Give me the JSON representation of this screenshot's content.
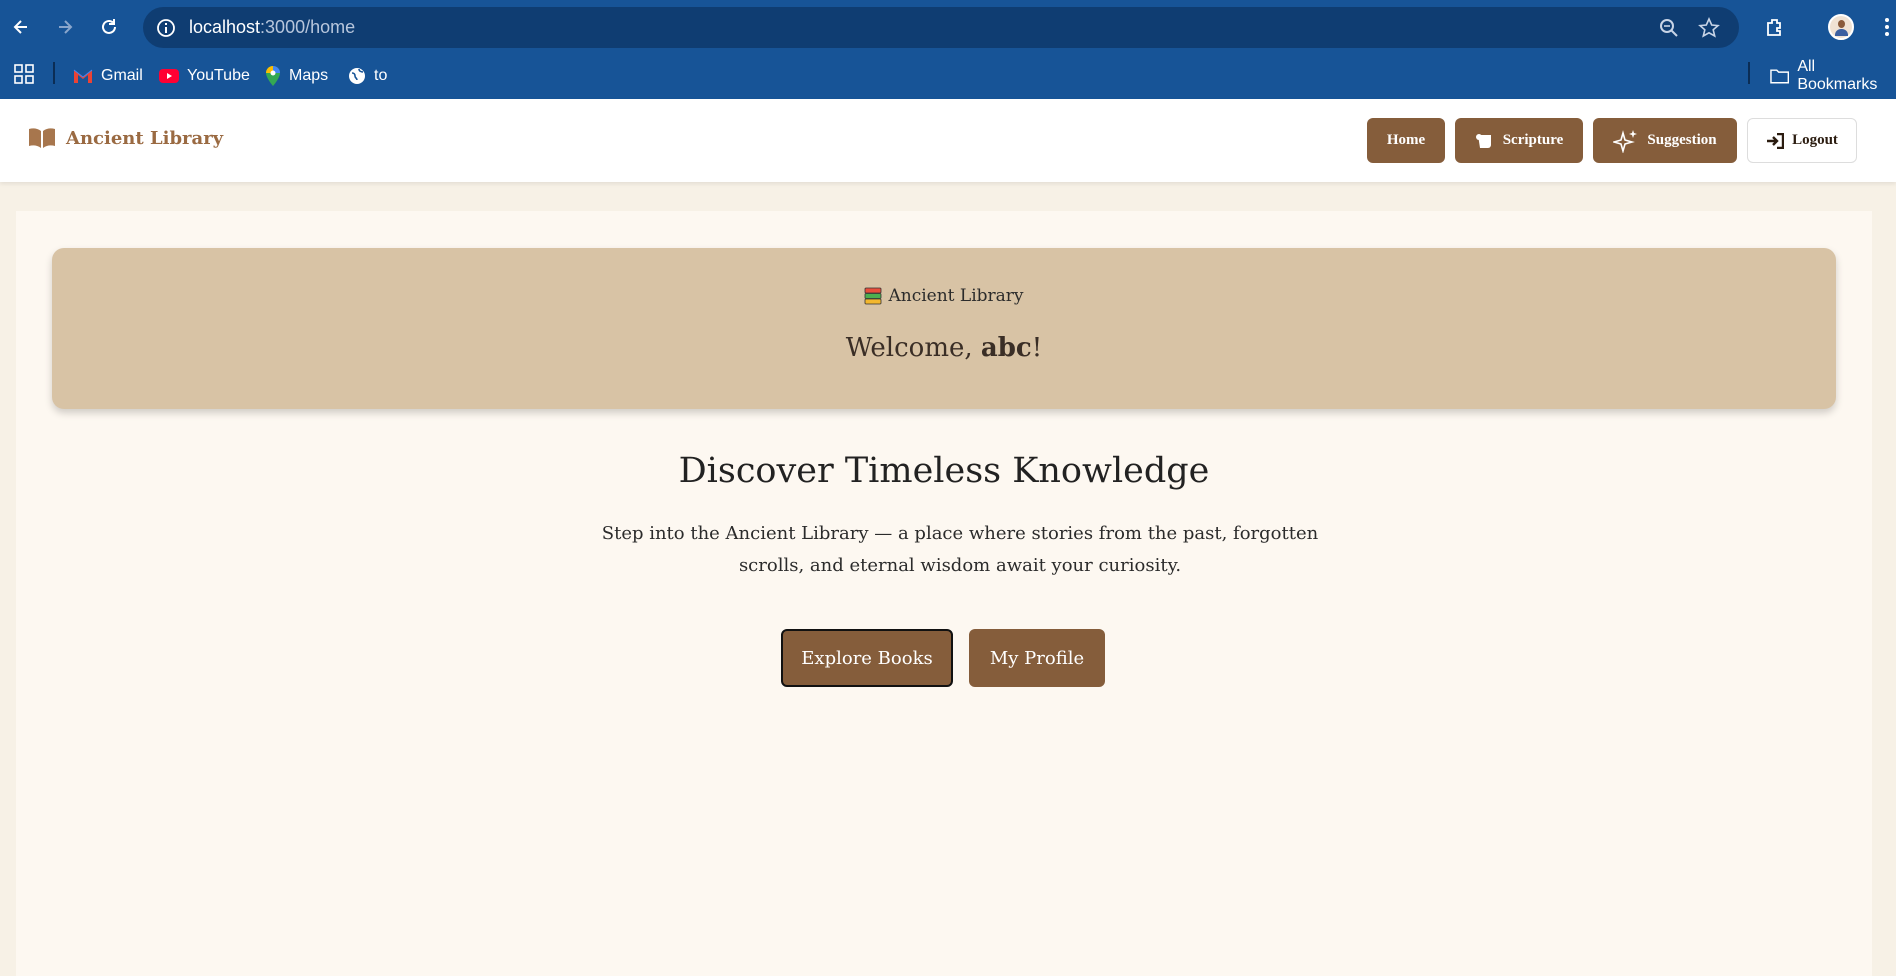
{
  "browser": {
    "url_host": "localhost",
    "url_path": ":3000/home",
    "bookmarks": [
      {
        "label": "Gmail"
      },
      {
        "label": "YouTube"
      },
      {
        "label": "Maps"
      },
      {
        "label": "to"
      }
    ],
    "all_bookmarks_label": "All Bookmarks"
  },
  "header": {
    "brand": "Ancient Library",
    "nav": {
      "home": "Home",
      "scripture": "Scripture",
      "suggestion": "Suggestion",
      "logout": "Logout"
    }
  },
  "welcome": {
    "label": "Ancient Library",
    "greeting_prefix": "Welcome, ",
    "username": "abc",
    "greeting_suffix": "!"
  },
  "hero": {
    "title": "Discover Timeless Knowledge",
    "description": "Step into the Ancient Library — a place where stories from the past, forgotten scrolls, and eternal wisdom await your curiosity.",
    "explore_button": "Explore Books",
    "profile_button": "My Profile"
  },
  "colors": {
    "chrome": "#175497",
    "brown": "#855d3b",
    "banner": "#d8c3a5",
    "page": "#fdf8f1"
  }
}
